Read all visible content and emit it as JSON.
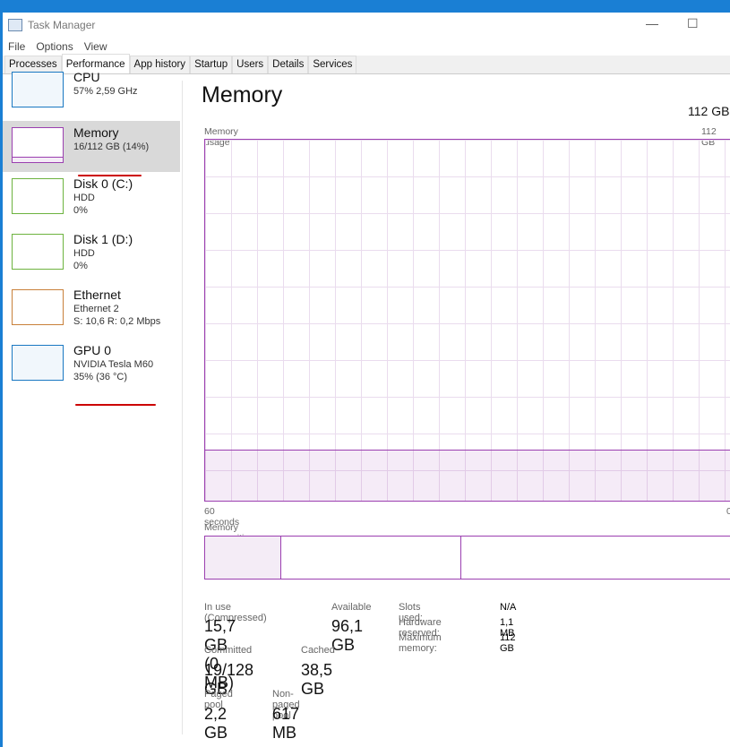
{
  "window": {
    "title": "Task Manager",
    "minimize": "—",
    "maximize": "☐"
  },
  "menu": [
    "File",
    "Options",
    "View"
  ],
  "tabs": [
    "Processes",
    "Performance",
    "App history",
    "Startup",
    "Users",
    "Details",
    "Services"
  ],
  "active_tab": "Performance",
  "sidebar": [
    {
      "name": "CPU",
      "line1": "57% 2,59 GHz",
      "line2": "",
      "color": "#1a78c2"
    },
    {
      "name": "Memory",
      "line1": "16/112 GB (14%)",
      "line2": "",
      "color": "#9b3fb0",
      "selected": true
    },
    {
      "name": "Disk 0 (C:)",
      "line1": "HDD",
      "line2": "0%",
      "color": "#6db33f"
    },
    {
      "name": "Disk 1 (D:)",
      "line1": "HDD",
      "line2": "0%",
      "color": "#6db33f"
    },
    {
      "name": "Ethernet",
      "line1": "Ethernet 2",
      "line2": "S: 10,6 R: 0,2 Mbps",
      "color": "#c8803a"
    },
    {
      "name": "GPU 0",
      "line1": "NVIDIA Tesla M60",
      "line2": "35% (36 °C)",
      "color": "#1a78c2"
    }
  ],
  "main": {
    "title": "Memory",
    "total": "112 GB",
    "graph_label": "Memory usage",
    "graph_max": "112 GB",
    "time_label": "60 seconds",
    "graph_min": "0",
    "usage_percent": 14,
    "composition_label": "Memory composition",
    "composition_segments_gb": {
      "in_use": 15.7,
      "standby": 38.5,
      "free": 57.8
    }
  },
  "stats": {
    "in_use_label": "In use (Compressed)",
    "in_use": "15,7 GB (0 MB)",
    "available_label": "Available",
    "available": "96,1 GB",
    "committed_label": "Committed",
    "committed": "19/128 GB",
    "cached_label": "Cached",
    "cached": "38,5 GB",
    "paged_label": "Paged pool",
    "paged": "2,2 GB",
    "nonpaged_label": "Non-paged pool",
    "nonpaged": "617 MB",
    "slots_label": "Slots used:",
    "slots": "N/A",
    "hwres_label": "Hardware reserved:",
    "hwres": "1,1 MB",
    "maxmem_label": "Maximum memory:",
    "maxmem": "112 GB"
  }
}
